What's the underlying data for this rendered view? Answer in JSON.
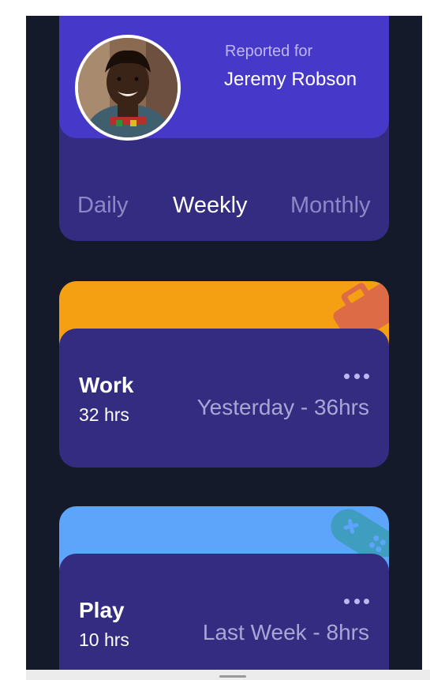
{
  "profile": {
    "reported_label": "Reported for",
    "name": "Jeremy Robson",
    "avatar_icon": "user-photo"
  },
  "tabs": [
    {
      "label": "Daily",
      "active": false
    },
    {
      "label": "Weekly",
      "active": true
    },
    {
      "label": "Monthly",
      "active": false
    }
  ],
  "activities": [
    {
      "title": "Work",
      "hours": "32 hrs",
      "previous": "Yesterday - 36hrs",
      "color": "#f59f12",
      "icon": "briefcase-icon"
    },
    {
      "title": "Play",
      "hours": "10 hrs",
      "previous": "Last Week - 8hrs",
      "color": "#5da5fa",
      "icon": "gamepad-icon"
    }
  ],
  "colors": {
    "background": "#141a2a",
    "card": "#332c80",
    "profile_accent": "#4638c8"
  }
}
